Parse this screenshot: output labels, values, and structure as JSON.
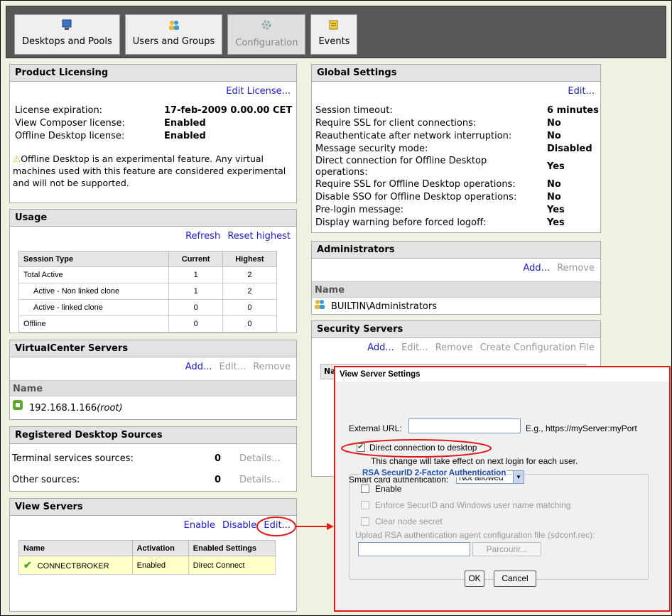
{
  "tabs": [
    {
      "label": "Desktops and Pools",
      "icon": "desktop-icon"
    },
    {
      "label": "Users and Groups",
      "icon": "users-icon"
    },
    {
      "label": "Configuration",
      "icon": "config-gear-icon"
    },
    {
      "label": "Events",
      "icon": "events-icon"
    }
  ],
  "product_licensing": {
    "title": "Product Licensing",
    "edit_license": "Edit License...",
    "rows": [
      {
        "label": "License expiration:",
        "value": "17-feb-2009 0.00.00 CET"
      },
      {
        "label": "View Composer license:",
        "value": "Enabled"
      },
      {
        "label": "Offline Desktop license:",
        "value": "Enabled"
      }
    ],
    "warning": "Offline Desktop is an experimental feature. Any virtual machines used with this feature are considered experimental and will not be supported."
  },
  "usage": {
    "title": "Usage",
    "refresh": "Refresh",
    "reset_highest": "Reset highest",
    "columns": [
      "Session Type",
      "Current",
      "Highest"
    ],
    "rows": [
      {
        "type": "Total Active",
        "current": "1",
        "highest": "2"
      },
      {
        "type": "Active - Non linked clone",
        "current": "1",
        "highest": "2"
      },
      {
        "type": "Active - linked clone",
        "current": "0",
        "highest": "0"
      },
      {
        "type": "Offline",
        "current": "0",
        "highest": "0"
      }
    ]
  },
  "vcenter": {
    "title": "VirtualCenter Servers",
    "add": "Add...",
    "edit": "Edit...",
    "remove": "Remove",
    "name_header": "Name",
    "server_ip": "192.168.1.166",
    "server_user": "(root)"
  },
  "desktop_sources": {
    "title": "Registered Desktop Sources",
    "rows": [
      {
        "label": "Terminal services sources:",
        "count": "0",
        "details": "Details..."
      },
      {
        "label": "Other sources:",
        "count": "0",
        "details": "Details..."
      }
    ]
  },
  "view_servers": {
    "title": "View Servers",
    "enable": "Enable",
    "disable": "Disable",
    "edit": "Edit...",
    "columns": [
      "Name",
      "Activation",
      "Enabled Settings"
    ],
    "row": {
      "name": "CONNECTBROKER",
      "activation": "Enabled",
      "settings": "Direct Connect"
    }
  },
  "global_settings": {
    "title": "Global Settings",
    "edit": "Edit...",
    "rows": [
      {
        "label": "Session timeout:",
        "value": "6 minutes"
      },
      {
        "label": "Require SSL for client connections:",
        "value": "No"
      },
      {
        "label": "Reauthenticate after network interruption:",
        "value": "No"
      },
      {
        "label": "Message security mode:",
        "value": "Disabled"
      },
      {
        "label": "Direct connection for Offline Desktop operations:",
        "value": "Yes"
      },
      {
        "label": "Require SSL for Offline Desktop operations:",
        "value": "No"
      },
      {
        "label": "Disable SSO for Offline Desktop operations:",
        "value": "No"
      },
      {
        "label": "Pre-login message:",
        "value": "Yes"
      },
      {
        "label": "Display warning before forced logoff:",
        "value": "Yes"
      }
    ]
  },
  "administrators": {
    "title": "Administrators",
    "add": "Add...",
    "remove": "Remove",
    "name_header": "Name",
    "entry": "BUILTIN\\Administrators"
  },
  "security_servers": {
    "title": "Security Servers",
    "add": "Add...",
    "edit": "Edit...",
    "remove": "Remove",
    "create_config": "Create Configuration File",
    "name_header_partial": "Nam"
  },
  "dialog": {
    "title": "View Server Settings",
    "external_url_label": "External URL:",
    "external_url_value": "",
    "external_url_hint": "E.g., https://myServer:myPort",
    "direct_connection_label": "Direct connection to desktop",
    "direct_connection_checked": true,
    "direct_connection_note": "This change will take effect on next login for each user.",
    "smart_card_label": "Smart card authentication:",
    "smart_card_value": "Not allowed",
    "rsa_group_title": "RSA SecurID 2-Factor Authentication",
    "enable_label": "Enable",
    "enforce_label": "Enforce SecurID and Windows user name matching",
    "clear_node_label": "Clear node secret",
    "upload_label": "Upload RSA authentication agent configuration file (sdconf.rec):",
    "browse_label": "Parcourir...",
    "ok_label": "OK",
    "cancel_label": "Cancel"
  },
  "colors": {
    "accent_link": "#1a1acc",
    "highlight_red": "#e01a1a",
    "selected_row": "#ffffc8"
  }
}
